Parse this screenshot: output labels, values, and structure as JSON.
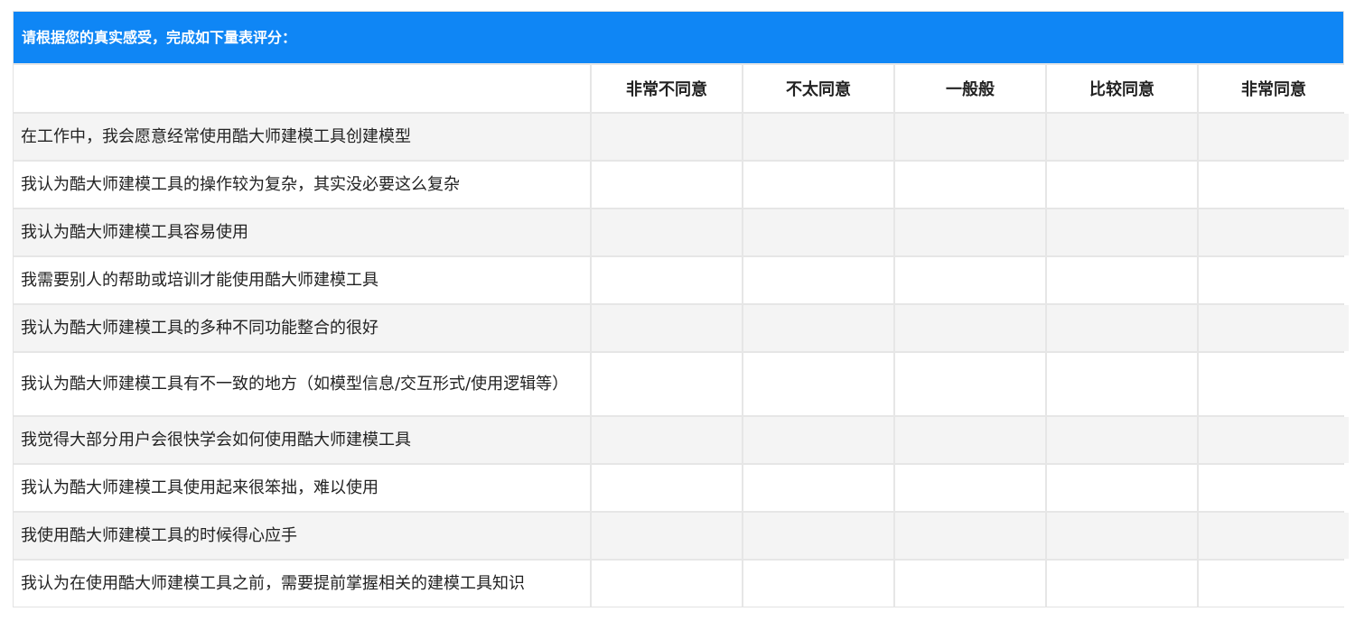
{
  "survey": {
    "instruction": "请根据您的真实感受，完成如下量表评分：",
    "columns": [
      "非常不同意",
      "不太同意",
      "一般般",
      "比较同意",
      "非常同意"
    ],
    "questions": [
      "在工作中，我会愿意经常使用酷大师建模工具创建模型",
      "我认为酷大师建模工具的操作较为复杂，其实没必要这么复杂",
      "我认为酷大师建模工具容易使用",
      "我需要别人的帮助或培训才能使用酷大师建模工具",
      "我认为酷大师建模工具的多种不同功能整合的很好",
      "我认为酷大师建模工具有不一致的地方（如模型信息/交互形式/使用逻辑等）",
      "我觉得大部分用户会很快学会如何使用酷大师建模工具",
      "我认为酷大师建模工具使用起来很笨拙，难以使用",
      "我使用酷大师建模工具的时候得心应手",
      "我认为在使用酷大师建模工具之前，需要提前掌握相关的建模工具知识"
    ]
  },
  "colors": {
    "banner": "#0f86f5",
    "row_alt": "#f4f4f4",
    "grid_line": "#e6e6e6"
  }
}
